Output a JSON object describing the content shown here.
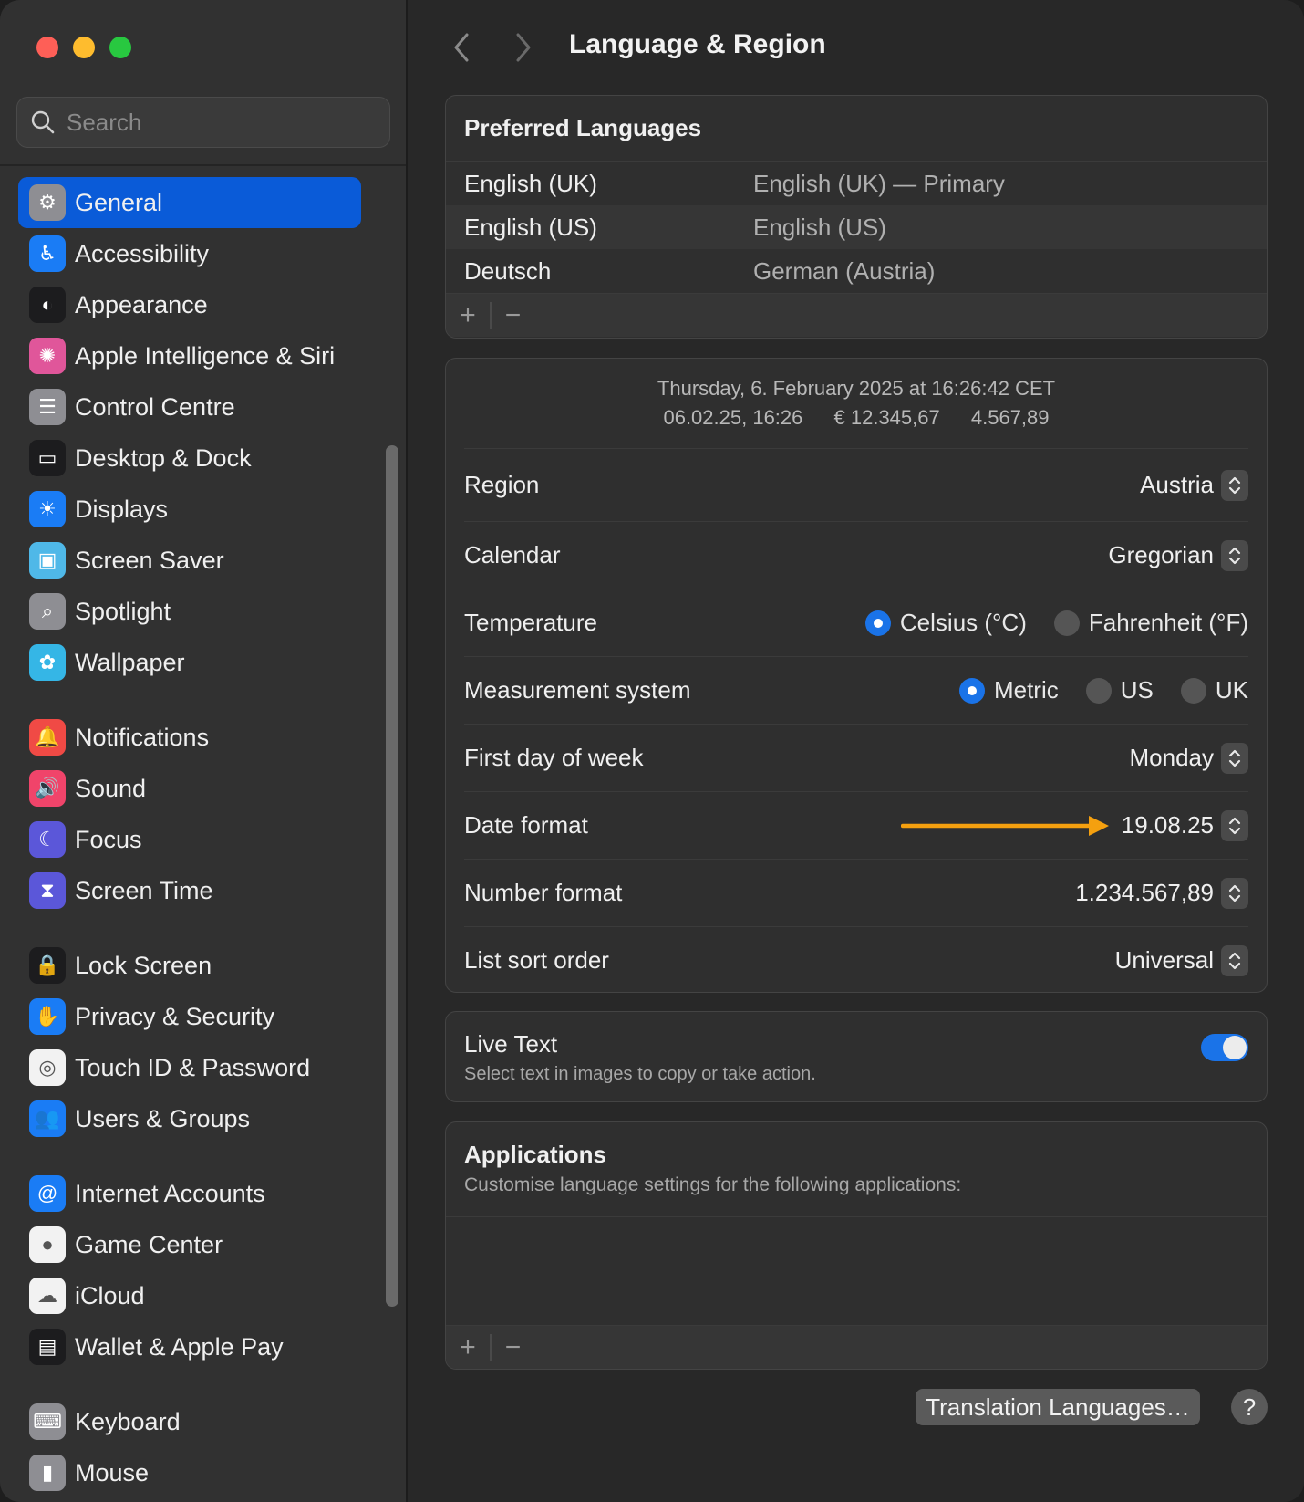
{
  "window": {
    "title": "Language & Region"
  },
  "search": {
    "placeholder": "Search"
  },
  "sidebar": {
    "items": [
      {
        "label": "General",
        "icon": "gear-icon",
        "color": "#8e8e93",
        "selected": true
      },
      {
        "label": "Accessibility",
        "icon": "accessibility-icon",
        "color": "#1a7cf5"
      },
      {
        "label": "Appearance",
        "icon": "appearance-icon",
        "color": "#1c1c1e"
      },
      {
        "label": "Apple Intelligence & Siri",
        "icon": "siri-icon",
        "color": "#e0569a"
      },
      {
        "label": "Control Centre",
        "icon": "control-centre-icon",
        "color": "#8e8e93"
      },
      {
        "label": "Desktop & Dock",
        "icon": "dock-icon",
        "color": "#1c1c1e"
      },
      {
        "label": "Displays",
        "icon": "sun-icon",
        "color": "#1a7cf5"
      },
      {
        "label": "Screen Saver",
        "icon": "screen-saver-icon",
        "color": "#4fb8e8"
      },
      {
        "label": "Spotlight",
        "icon": "spotlight-icon",
        "color": "#8e8e93"
      },
      {
        "label": "Wallpaper",
        "icon": "flower-icon",
        "color": "#35b6e6"
      },
      {
        "label": "Notifications",
        "icon": "bell-icon",
        "color": "#f04a45"
      },
      {
        "label": "Sound",
        "icon": "speaker-icon",
        "color": "#f0446a"
      },
      {
        "label": "Focus",
        "icon": "moon-icon",
        "color": "#5b57d9"
      },
      {
        "label": "Screen Time",
        "icon": "hourglass-icon",
        "color": "#5b57d9"
      },
      {
        "label": "Lock Screen",
        "icon": "lock-icon",
        "color": "#1c1c1e"
      },
      {
        "label": "Privacy & Security",
        "icon": "hand-icon",
        "color": "#1a7cf5"
      },
      {
        "label": "Touch ID & Password",
        "icon": "fingerprint-icon",
        "color": "#f2f2f2"
      },
      {
        "label": "Users & Groups",
        "icon": "users-icon",
        "color": "#1a7cf5"
      },
      {
        "label": "Internet Accounts",
        "icon": "at-icon",
        "color": "#1a7cf5"
      },
      {
        "label": "Game Center",
        "icon": "game-center-icon",
        "color": "#f2f2f2"
      },
      {
        "label": "iCloud",
        "icon": "cloud-icon",
        "color": "#f2f2f2"
      },
      {
        "label": "Wallet & Apple Pay",
        "icon": "wallet-icon",
        "color": "#1c1c1e"
      },
      {
        "label": "Keyboard",
        "icon": "keyboard-icon",
        "color": "#8e8e93"
      },
      {
        "label": "Mouse",
        "icon": "mouse-icon",
        "color": "#8e8e93"
      }
    ],
    "groups": [
      [
        0,
        1,
        2,
        3,
        4,
        5,
        6,
        7,
        8,
        9
      ],
      [
        10,
        11,
        12,
        13
      ],
      [
        14,
        15,
        16,
        17
      ],
      [
        18,
        19,
        20,
        21
      ],
      [
        22,
        23
      ]
    ]
  },
  "preferred_languages": {
    "heading": "Preferred Languages",
    "rows": [
      {
        "name": "English (UK)",
        "detail": "English (UK) — Primary"
      },
      {
        "name": "English (US)",
        "detail": "English (US)"
      },
      {
        "name": "Deutsch",
        "detail": "German (Austria)"
      }
    ],
    "add": "+",
    "remove": "−"
  },
  "preview": {
    "line1": "Thursday, 6. February 2025 at 16:26:42 CET",
    "date": "06.02.25, 16:26",
    "currency": "€ 12.345,67",
    "number": "4.567,89"
  },
  "settings": {
    "region": {
      "label": "Region",
      "value": "Austria"
    },
    "calendar": {
      "label": "Calendar",
      "value": "Gregorian"
    },
    "temperature": {
      "label": "Temperature",
      "options": [
        "Celsius (°C)",
        "Fahrenheit (°F)"
      ],
      "selected": "Celsius (°C)"
    },
    "measurement": {
      "label": "Measurement system",
      "options": [
        "Metric",
        "US",
        "UK"
      ],
      "selected": "Metric"
    },
    "first_day": {
      "label": "First day of week",
      "value": "Monday"
    },
    "date_format": {
      "label": "Date format",
      "value": "19.08.25"
    },
    "number_format": {
      "label": "Number format",
      "value": "1.234.567,89"
    },
    "sort_order": {
      "label": "List sort order",
      "value": "Universal"
    }
  },
  "live_text": {
    "title": "Live Text",
    "subtitle": "Select text in images to copy or take action.",
    "enabled": true
  },
  "applications": {
    "heading": "Applications",
    "subtitle": "Customise language settings for the following applications:",
    "add": "+",
    "remove": "−"
  },
  "footer": {
    "translation_button": "Translation Languages…",
    "help": "?"
  },
  "colors": {
    "accent": "#1a73e8",
    "annotation_arrow": "#f5a00f",
    "selected_item": "#0a5bd8"
  }
}
